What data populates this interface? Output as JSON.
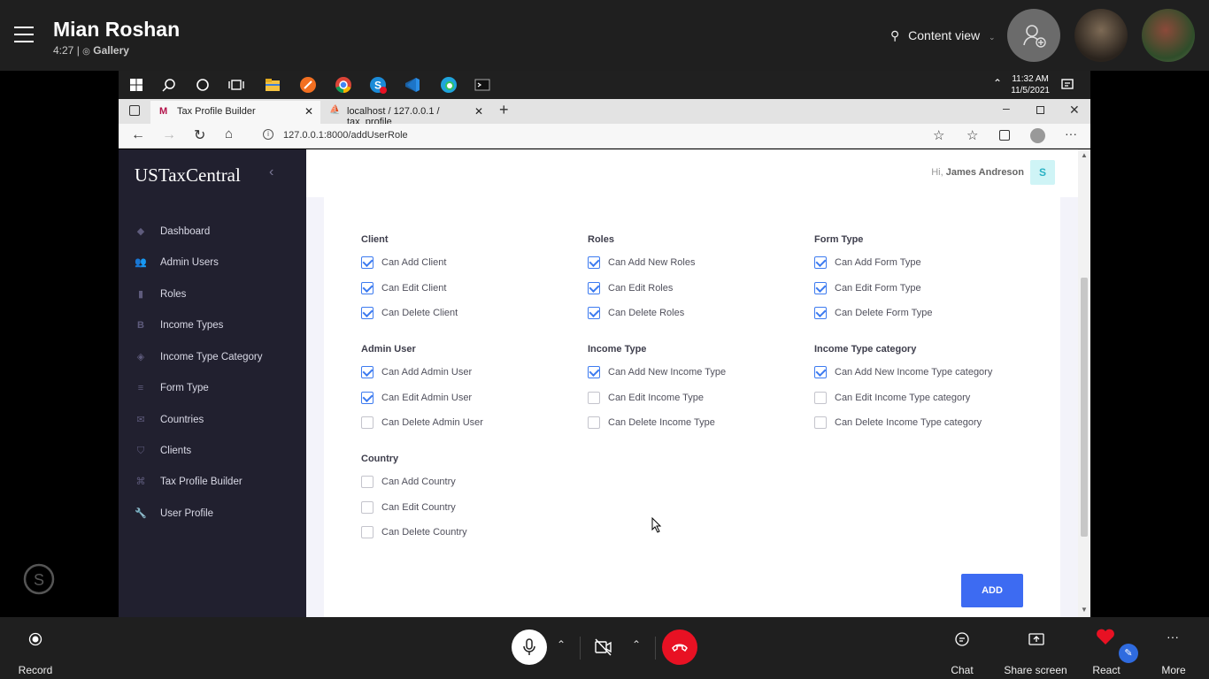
{
  "skype": {
    "caller_name": "Mian Roshan",
    "duration": "4:27",
    "view_mode": "Gallery",
    "content_view": "Content view",
    "bottom": {
      "record": "Record",
      "chat": "Chat",
      "share_screen": "Share screen",
      "react": "React",
      "more": "More"
    }
  },
  "taskbar": {
    "time": "11:32 AM",
    "date": "11/5/2021"
  },
  "browser": {
    "tabs": [
      {
        "label": "Tax Profile Builder"
      },
      {
        "label": "localhost / 127.0.0.1 / tax_profile"
      }
    ],
    "url": "127.0.0.1:8000/addUserRole"
  },
  "app": {
    "brand": "USTaxCentral",
    "greeting": "Hi,",
    "user_name": "James Andreson",
    "user_initial": "S",
    "nav": [
      {
        "label": "Dashboard",
        "icon": "diamond-icon"
      },
      {
        "label": "Admin Users",
        "icon": "users-icon"
      },
      {
        "label": "Roles",
        "icon": "lock-icon"
      },
      {
        "label": "Income Types",
        "icon": "bold-b-icon"
      },
      {
        "label": "Income Type Category",
        "icon": "tag-icon"
      },
      {
        "label": "Form Type",
        "icon": "list-icon"
      },
      {
        "label": "Countries",
        "icon": "mail-icon"
      },
      {
        "label": "Clients",
        "icon": "shield-icon"
      },
      {
        "label": "Tax Profile Builder",
        "icon": "command-icon"
      },
      {
        "label": "User Profile",
        "icon": "wrench-icon"
      }
    ],
    "sections": [
      {
        "title": "Client",
        "perms": [
          {
            "label": "Can Add Client",
            "checked": true
          },
          {
            "label": "Can Edit Client",
            "checked": true
          },
          {
            "label": "Can Delete Client",
            "checked": true
          }
        ]
      },
      {
        "title": "Roles",
        "perms": [
          {
            "label": "Can Add New Roles",
            "checked": true
          },
          {
            "label": "Can Edit Roles",
            "checked": true
          },
          {
            "label": "Can Delete Roles",
            "checked": true
          }
        ]
      },
      {
        "title": "Form Type",
        "perms": [
          {
            "label": "Can Add Form Type",
            "checked": true
          },
          {
            "label": "Can Edit Form Type",
            "checked": true
          },
          {
            "label": "Can Delete Form Type",
            "checked": true
          }
        ]
      },
      {
        "title": "Admin User",
        "perms": [
          {
            "label": "Can Add Admin User",
            "checked": true
          },
          {
            "label": "Can Edit Admin User",
            "checked": true
          },
          {
            "label": "Can Delete Admin User",
            "checked": false
          }
        ]
      },
      {
        "title": "Income Type",
        "perms": [
          {
            "label": "Can Add New Income Type",
            "checked": true
          },
          {
            "label": "Can Edit Income Type",
            "checked": false
          },
          {
            "label": "Can Delete Income Type",
            "checked": false
          }
        ]
      },
      {
        "title": "Income Type category",
        "perms": [
          {
            "label": "Can Add New Income Type category",
            "checked": true
          },
          {
            "label": "Can Edit Income Type category",
            "checked": false
          },
          {
            "label": "Can Delete Income Type category",
            "checked": false
          }
        ]
      },
      {
        "title": "Country",
        "perms": [
          {
            "label": "Can Add Country",
            "checked": false
          },
          {
            "label": "Can Edit Country",
            "checked": false
          },
          {
            "label": "Can Delete Country",
            "checked": false
          }
        ]
      }
    ],
    "add_button": "ADD"
  },
  "colors": {
    "accent": "#3d6bf2",
    "sidebar": "#21202f",
    "end_call": "#e81123"
  }
}
